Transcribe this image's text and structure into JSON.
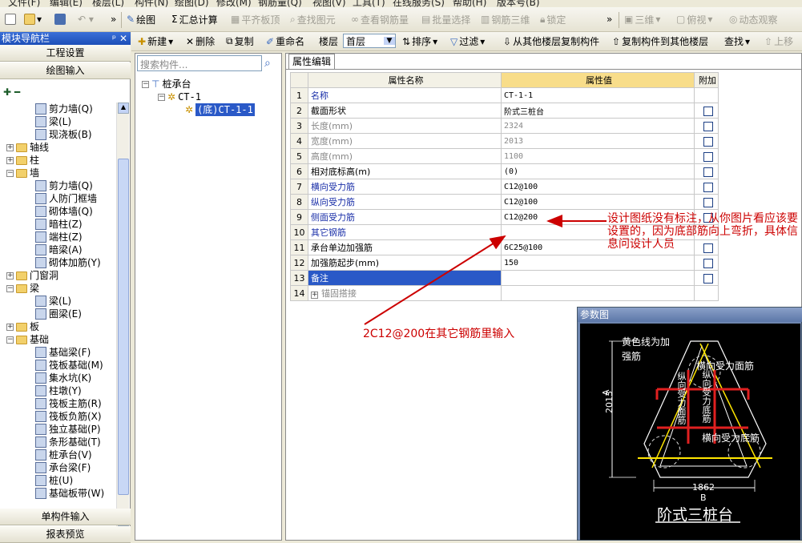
{
  "menubar": [
    "文件(F)",
    "编辑(E)",
    "楼层(L)",
    "构件(N)",
    "绘图(D)",
    "修改(M)",
    "钢筋量(Q)",
    "视图(V)",
    "工具(T)",
    "在线服务(S)",
    "帮助(H)",
    "版本号(B)"
  ],
  "toolbar1": {
    "draw": "绘图",
    "sum_calc": "汇总计算",
    "flat_slab": "平齐板顶",
    "find_element": "查找图元",
    "view_rebar": "查看钢筋量",
    "batch_select": "批量选择",
    "rebar_3d": "钢筋三维",
    "lock": "锁定",
    "view_3d": "三维",
    "top_view": "俯视",
    "dynamic_view": "动态观察"
  },
  "toolbar2": {
    "new": "新建",
    "delete": "删除",
    "copy": "复制",
    "rename": "重命名",
    "floor_label": "楼层",
    "floor_value": "首层",
    "sort": "排序",
    "filter": "过滤",
    "copy_from_floor": "从其他楼层复制构件",
    "copy_to_floor": "复制构件到其他楼层",
    "find": "查找",
    "move_up": "上移"
  },
  "nav": {
    "title": "模块导航栏",
    "project_settings": "工程设置",
    "draw_input": "绘图输入",
    "single_input": "单构件输入",
    "report_preview": "报表预览",
    "tree": [
      {
        "label": "剪力墙(Q)",
        "level": 2
      },
      {
        "label": "梁(L)",
        "level": 2
      },
      {
        "label": "现浇板(B)",
        "level": 2
      },
      {
        "label": "轴线",
        "level": 0,
        "folder": true,
        "toggle": "+"
      },
      {
        "label": "柱",
        "level": 0,
        "folder": true,
        "toggle": "+"
      },
      {
        "label": "墙",
        "level": 0,
        "folder": true,
        "toggle": "-"
      },
      {
        "label": "剪力墙(Q)",
        "level": 2
      },
      {
        "label": "人防门框墙",
        "level": 2
      },
      {
        "label": "砌体墙(Q)",
        "level": 2
      },
      {
        "label": "暗柱(Z)",
        "level": 2
      },
      {
        "label": "端柱(Z)",
        "level": 2
      },
      {
        "label": "暗梁(A)",
        "level": 2
      },
      {
        "label": "砌体加筋(Y)",
        "level": 2
      },
      {
        "label": "门窗洞",
        "level": 0,
        "folder": true,
        "toggle": "+"
      },
      {
        "label": "梁",
        "level": 0,
        "folder": true,
        "toggle": "-"
      },
      {
        "label": "梁(L)",
        "level": 2
      },
      {
        "label": "圈梁(E)",
        "level": 2
      },
      {
        "label": "板",
        "level": 0,
        "folder": true,
        "toggle": "+"
      },
      {
        "label": "基础",
        "level": 0,
        "folder": true,
        "toggle": "-"
      },
      {
        "label": "基础梁(F)",
        "level": 2
      },
      {
        "label": "筏板基础(M)",
        "level": 2
      },
      {
        "label": "集水坑(K)",
        "level": 2
      },
      {
        "label": "柱墩(Y)",
        "level": 2
      },
      {
        "label": "筏板主筋(R)",
        "level": 2
      },
      {
        "label": "筏板负筋(X)",
        "level": 2
      },
      {
        "label": "独立基础(P)",
        "level": 2
      },
      {
        "label": "条形基础(T)",
        "level": 2
      },
      {
        "label": "桩承台(V)",
        "level": 2
      },
      {
        "label": "承台梁(F)",
        "level": 2
      },
      {
        "label": "桩(U)",
        "level": 2
      },
      {
        "label": "基础板带(W)",
        "level": 2
      }
    ]
  },
  "component_panel": {
    "search_placeholder": "搜索构件...",
    "root": "桩承台",
    "child": "CT-1",
    "leaf": "(底)CT-1-1"
  },
  "property_panel": {
    "tab": "属性编辑",
    "col_name": "属性名称",
    "col_value": "属性值",
    "col_extra": "附加",
    "rows": [
      {
        "n": "1",
        "name": "名称",
        "value": "CT-1-1",
        "style": "blue",
        "check": false
      },
      {
        "n": "2",
        "name": "截面形状",
        "value": "阶式三桩台",
        "style": "normal",
        "check": true
      },
      {
        "n": "3",
        "name": "长度(mm)",
        "value": "2324",
        "style": "gray",
        "check": true
      },
      {
        "n": "4",
        "name": "宽度(mm)",
        "value": "2013",
        "style": "gray",
        "check": true
      },
      {
        "n": "5",
        "name": "高度(mm)",
        "value": "1100",
        "style": "gray",
        "check": true
      },
      {
        "n": "6",
        "name": "相对底标高(m)",
        "value": "(0)",
        "style": "normal",
        "check": true
      },
      {
        "n": "7",
        "name": "横向受力筋",
        "value": "C12@100",
        "style": "blue",
        "check": true
      },
      {
        "n": "8",
        "name": "纵向受力筋",
        "value": "C12@100",
        "style": "blue",
        "check": true
      },
      {
        "n": "9",
        "name": "侧面受力筋",
        "value": "C12@200",
        "style": "blue",
        "check": true
      },
      {
        "n": "10",
        "name": "其它钢筋",
        "value": "",
        "style": "blue",
        "check": false
      },
      {
        "n": "11",
        "name": "承台单边加强筋",
        "value": "6C25@100",
        "style": "normal",
        "check": true
      },
      {
        "n": "12",
        "name": "加强筋起步(mm)",
        "value": "150",
        "style": "normal",
        "check": true
      },
      {
        "n": "13",
        "name": "备注",
        "value": "",
        "style": "selected",
        "check": true
      },
      {
        "n": "14",
        "name": "锚固搭接",
        "value": "",
        "style": "gray",
        "check": false,
        "expand": true
      }
    ]
  },
  "annotations": {
    "note1": "设计图纸没有标注，从你图片看应该要设置的，因为底部筋向上弯折，具体信息问设计人员",
    "note2": "2C12@200在其它钢筋里输入"
  },
  "param_diagram": {
    "title": "参数图",
    "label_yellow": "黄色线为加强筋",
    "label_top_rebar": "横向受力面筋",
    "label_bottom_rebar": "横向受力底筋",
    "label_v_face": "纵向受力面筋",
    "label_v_bottom": "纵向受力底筋",
    "dim_a": "2013",
    "dim_a_letter": "A",
    "dim_b": "1862",
    "dim_b_letter": "B",
    "caption": "阶式三桩台"
  }
}
